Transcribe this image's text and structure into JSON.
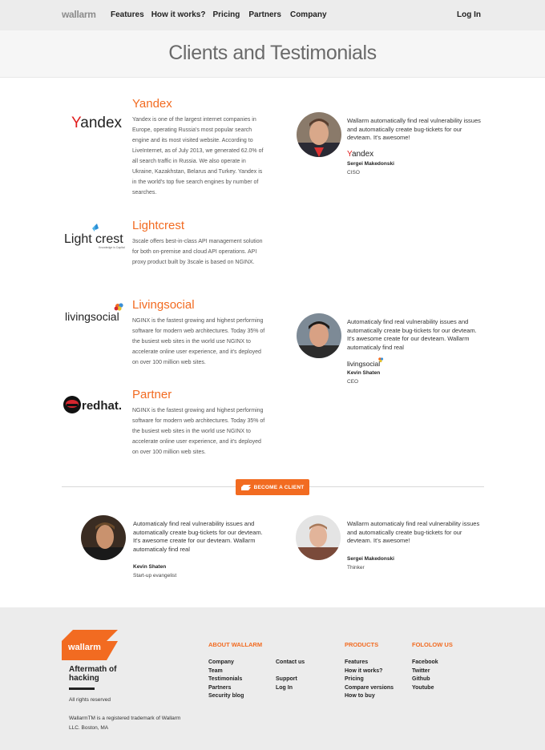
{
  "header": {
    "logo": "wallarm",
    "nav": [
      "Features",
      "How it works?",
      "Pricing",
      "Partners",
      "Company"
    ],
    "login": "Log In"
  },
  "hero": {
    "title": "Clients and Testimonials"
  },
  "clients": [
    {
      "name": "Yandex",
      "logo_text": "Yandex",
      "description": "Yandex is one of the largest internet companies in Europe, operating Russia's most popular search engine and its most visited website. According to LiveInternet, as of July 2013, we generated 62.0% of all search traffic in Russia. We also operate in Ukraine, Kazakhstan, Belarus and Turkey. Yandex is in the world's top five search engines by number of searches."
    },
    {
      "name": "Lightcrest",
      "logo_text": "Lightcrest",
      "logo_sub": "Knowledge is Capital",
      "description": "3scale offers best-in-class API management solution for both on-premise and cloud API operations. API proxy product built by 3scale is based on NGINX."
    },
    {
      "name": "Livingsocial",
      "logo_text": "livingsocial",
      "description": "NGINX is the fastest growing and highest performing software for modern web architectures. Today 35% of the busiest web sites in the world use NGINX to accelerate online user experience, and it's deployed on over 100 million web sites."
    },
    {
      "name": "Partner",
      "logo_text": "redhat.",
      "description": "NGINX is the fastest growing and highest performing software for modern web architectures. Today 35% of the busiest web sites in the world use NGINX to accelerate online user experience, and it's deployed on over 100 million web sites."
    }
  ],
  "testimonials": [
    {
      "quote": "Wallarm automatically find real vulnerability issues and automatically create bug-tickets for our devteam. It's awesome!",
      "company": "Yandex",
      "name": "Sergei Makedonski",
      "role": "CISO"
    },
    {
      "quote": "Automaticaly find real vulnerability issues and automatically create bug-tickets for our devteam. It's awesome create for our devteam. Wallarm automaticaly find real",
      "company": "livingsocial",
      "name": "Kevin Shaten",
      "role": "CEO"
    },
    {
      "quote": "Automaticaly find real vulnerability issues and automatically create bug-tickets for our devteam. It's awesome create for our devteam. Wallarm automaticaly find real",
      "name": "Kevin Shaten",
      "role": "Start-up evangelist"
    },
    {
      "quote": "Wallarm automaticaly find real vulnerability issues and automatically create bug-tickets for our devteam. It's awesome!",
      "name": "Sergei Makedonski",
      "role": "Thinker"
    }
  ],
  "cta": {
    "label": "BECOME A CLIENT"
  },
  "footer": {
    "logo": "wallarm",
    "tagline": "Aftermath of hacking",
    "rights": "All rights reserved",
    "trademark": "WallarmTM is a registered trademark of Wallarm LLC. Boston, MA",
    "about_heading": "ABOUT WALLARM",
    "about_col1": [
      "Company",
      "Team",
      "Testimonials",
      "Partners",
      "Security blog"
    ],
    "about_col2": [
      "Contact us",
      "",
      "Support",
      "Log In"
    ],
    "products_heading": "PRODUCTS",
    "products": [
      "Features",
      "How it works?",
      "Pricing",
      "Compare versions",
      "How to buy"
    ],
    "follow_heading": "FOLOLOW US",
    "follow": [
      "Facebook",
      "Twitter",
      "Github",
      "Youtube"
    ]
  },
  "colors": {
    "accent": "#f26b21",
    "footer_bg": "#ececec",
    "header_bg": "#ececec"
  }
}
